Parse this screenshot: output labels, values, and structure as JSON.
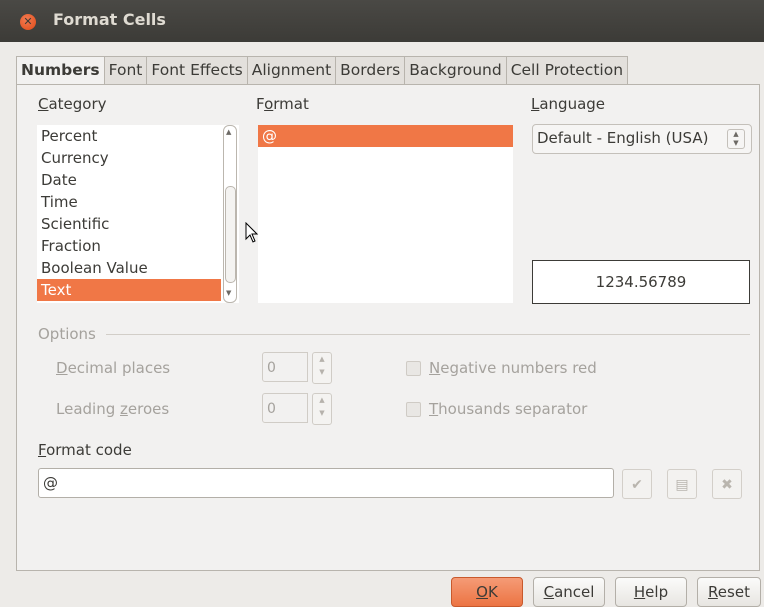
{
  "window": {
    "title": "Format Cells"
  },
  "tabs": [
    {
      "label": "Numbers",
      "active": true
    },
    {
      "label": "Font",
      "active": false
    },
    {
      "label": "Font Effects",
      "active": false
    },
    {
      "label": "Alignment",
      "active": false
    },
    {
      "label": "Borders",
      "active": false
    },
    {
      "label": "Background",
      "active": false
    },
    {
      "label": "Cell Protection",
      "active": false
    }
  ],
  "category": {
    "label_mnemonic": "C",
    "label_rest": "ategory",
    "items": [
      "Percent",
      "Currency",
      "Date",
      "Time",
      "Scientific",
      "Fraction",
      "Boolean Value",
      "Text"
    ],
    "selected": "Text"
  },
  "format": {
    "label_pre": "F",
    "label_mnemonic": "o",
    "label_rest": "rmat",
    "items": [
      "@"
    ],
    "selected": "@"
  },
  "language": {
    "label_mnemonic": "L",
    "label_rest": "anguage",
    "value": "Default - English (USA)"
  },
  "preview": {
    "value": "1234.56789"
  },
  "options": {
    "heading": "Options",
    "decimal_places": {
      "label_mnemonic": "D",
      "label_rest": "ecimal places",
      "value": "0"
    },
    "leading_zeroes": {
      "label_pre": "Leading ",
      "label_mnemonic": "z",
      "label_rest": "eroes",
      "value": "0"
    },
    "negative_red": {
      "label_mnemonic": "N",
      "label_rest": "egative numbers red",
      "checked": false
    },
    "thousands_sep": {
      "label_mnemonic": "T",
      "label_rest": "housands separator",
      "checked": false
    }
  },
  "format_code": {
    "label_mnemonic": "F",
    "label_rest": "ormat code",
    "value": "@"
  },
  "icons": {
    "accept": "check-icon",
    "comment": "edit-comment-icon",
    "remove": "delete-icon"
  },
  "buttons": {
    "ok": {
      "mnemonic": "O",
      "rest": "K"
    },
    "cancel": {
      "mnemonic": "C",
      "rest": "ancel"
    },
    "help": {
      "mnemonic": "H",
      "rest": "elp"
    },
    "reset": {
      "mnemonic": "R",
      "rest": "eset"
    }
  },
  "colors": {
    "accent": "#f07746",
    "titlebar": "#3c3b37",
    "close": "#df4a16"
  }
}
